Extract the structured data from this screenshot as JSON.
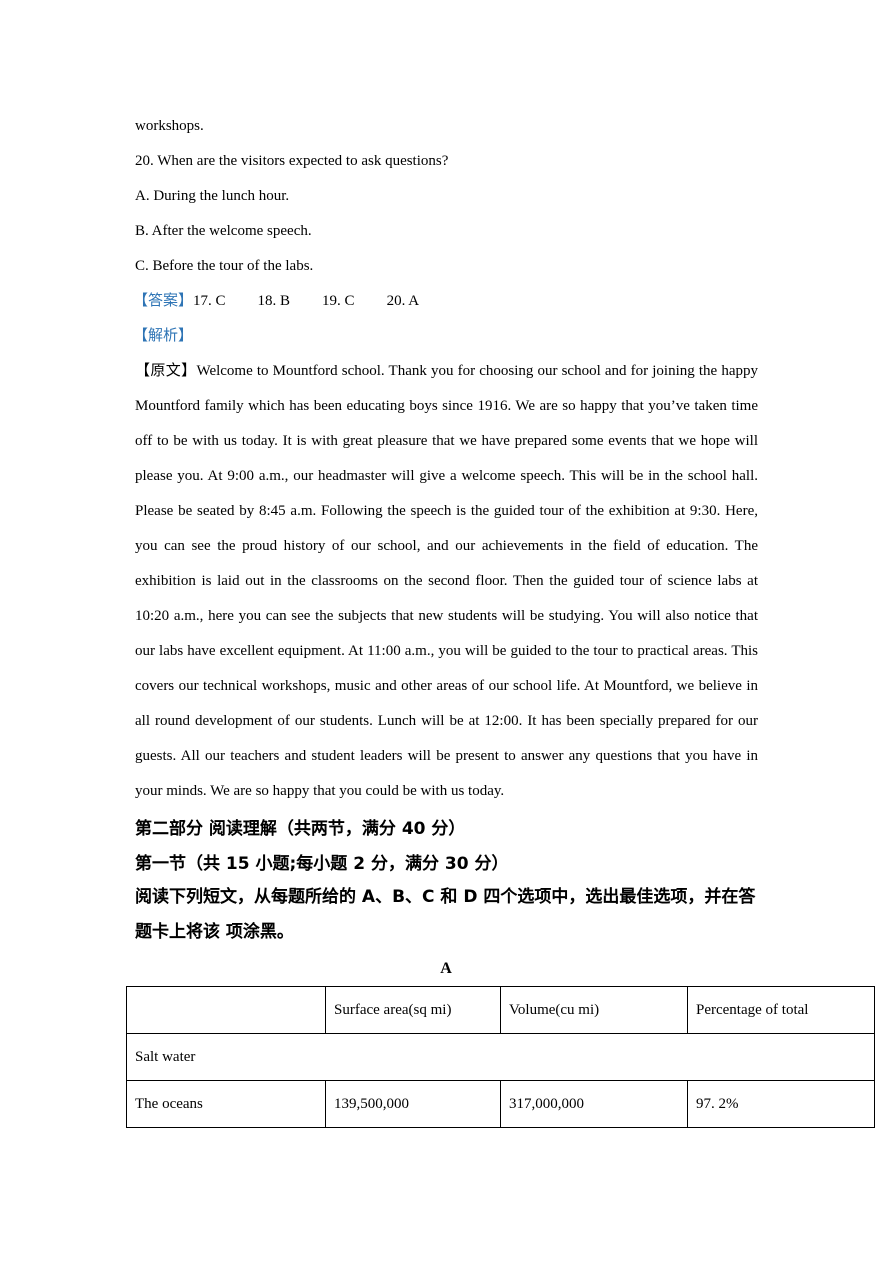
{
  "top_continuation": "workshops.",
  "question20": {
    "stem": "20. When are the visitors expected to ask questions?",
    "options": [
      "A. During the lunch hour.",
      "B. After the welcome speech.",
      "C. Before the tour of the labs."
    ]
  },
  "answer": {
    "label": "【答案】",
    "items": [
      "17. C",
      "18. B",
      "19. C",
      "20. A"
    ]
  },
  "analysis_label": "【解析】",
  "original_text": {
    "label": "【原文】",
    "body": "Welcome to Mountford school. Thank you for choosing our school and for joining the happy Mountford family which has been educating boys since 1916. We are so happy that you’ve taken time off to be with us today. It is with great pleasure that we have prepared some events that we hope will please you. At 9:00 a.m., our headmaster will give a welcome speech. This will be in the school hall. Please be seated by 8:45 a.m. Following the speech is the guided tour of the exhibition at 9:30. Here, you can see the proud history of our school, and our achievements in the field of education. The exhibition is laid out in the classrooms on the second floor. Then the guided tour of science labs at 10:20 a.m., here you can see the subjects that new students will be studying. You will also notice that our labs have excellent equipment. At 11:00 a.m., you will be guided to the tour to practical areas. This covers our technical workshops, music and other areas of our school life. At Mountford, we believe in all round development of our students. Lunch will be at 12:00. It has been specially prepared for our guests. All our teachers and student leaders will be present to answer any questions that you have in your minds. We are so happy that you could be with us today."
  },
  "part2_heading": "第二部分 阅读理解（共两节，满分 40 分）",
  "section1_heading": "第一节（共 15 小题;每小题 2 分，满分 30 分）",
  "instructions": "阅读下列短文，从每题所给的 A、B、C 和 D 四个选项中，选出最佳选项，并在答题卡上将该 项涂黑。",
  "passage_label": "A",
  "table": {
    "headers": [
      "",
      "Surface area(sq mi)",
      "Volume(cu mi)",
      "Percentage of total"
    ],
    "section_row": "Salt water",
    "rows": [
      [
        "The oceans",
        "139,500,000",
        "317,000,000",
        "97. 2%"
      ]
    ]
  },
  "colors": {
    "label_blue": "#2e74b5"
  }
}
